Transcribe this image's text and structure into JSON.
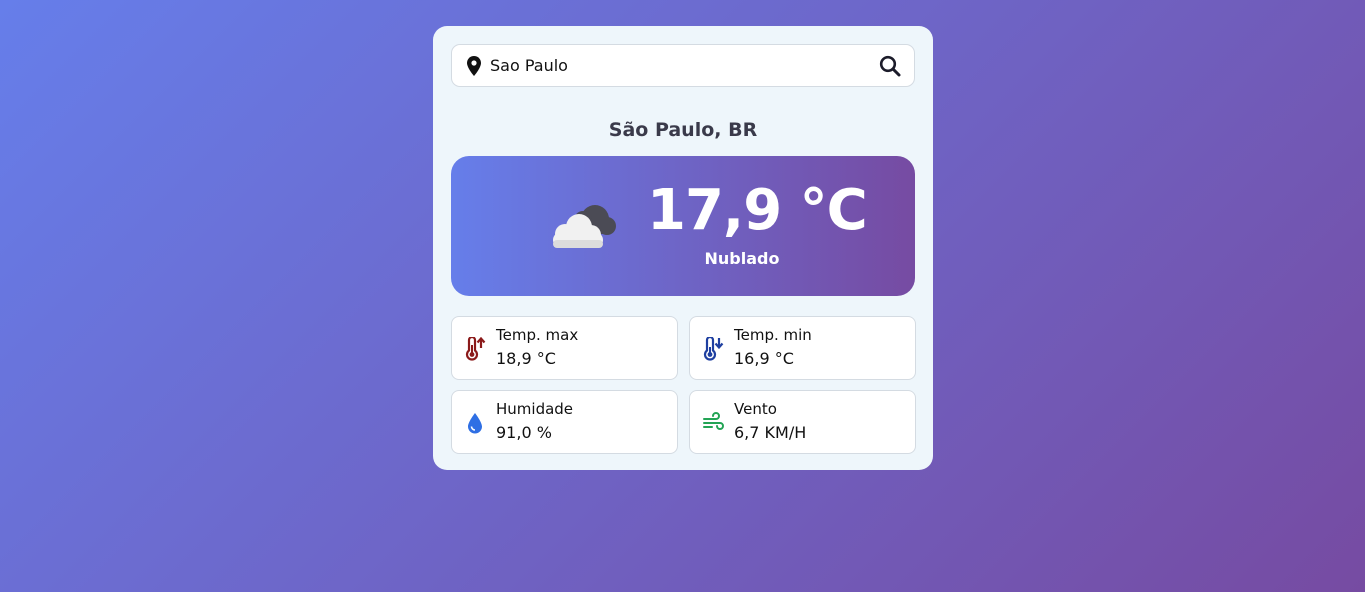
{
  "search": {
    "value": "Sao Paulo",
    "location_icon": "map-pin-icon",
    "search_icon": "magnifier-icon"
  },
  "location": {
    "name": "São Paulo, BR"
  },
  "current": {
    "temperature": "17,9 °C",
    "condition": "Nublado",
    "icon": "cloudy-icon"
  },
  "stats": {
    "max": {
      "label": "Temp. max",
      "value": "18,9 °C",
      "icon": "thermometer-up-icon",
      "color": "#8b1a1a"
    },
    "min": {
      "label": "Temp. min",
      "value": "16,9 °C",
      "icon": "thermometer-down-icon",
      "color": "#1e3fa0"
    },
    "humidity": {
      "label": "Humidade",
      "value": "91,0 %",
      "icon": "droplet-icon",
      "color": "#2f6fe4"
    },
    "wind": {
      "label": "Vento",
      "value": "6,7 KM/H",
      "icon": "wind-icon",
      "color": "#23a455"
    }
  },
  "colors": {
    "bg_start": "#667eea",
    "bg_end": "#764ba2",
    "card_bg": "#eef6fb"
  }
}
